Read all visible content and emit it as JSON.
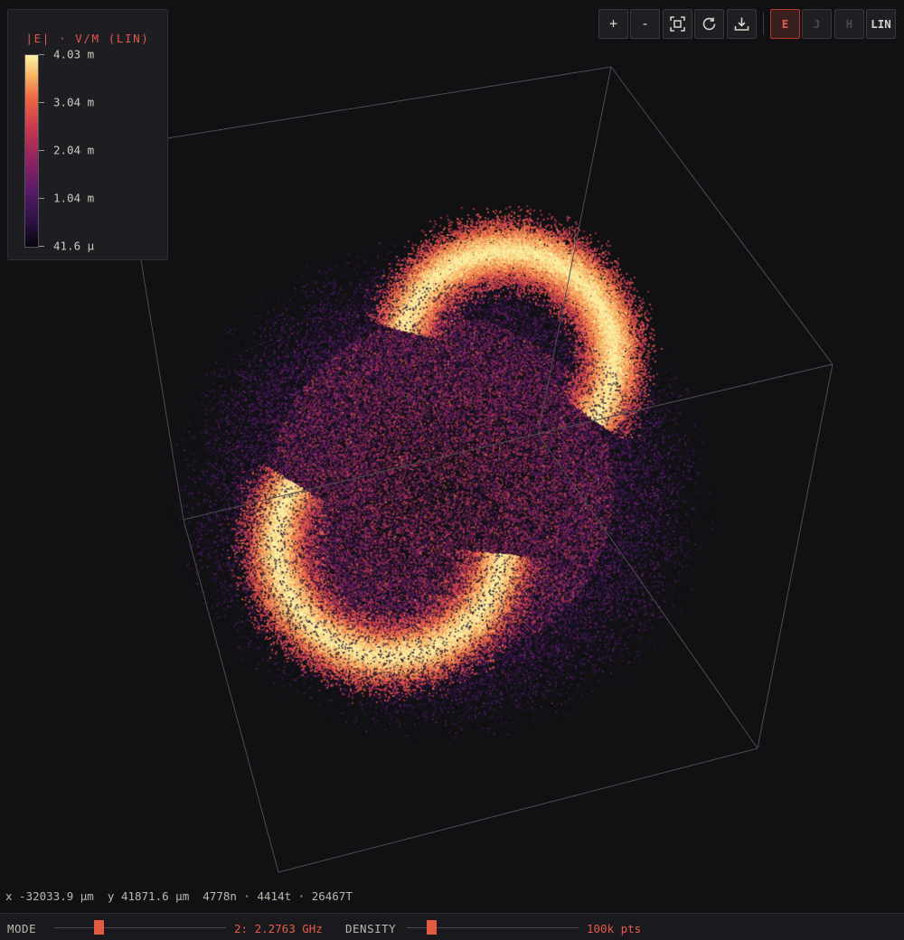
{
  "legend": {
    "title": "|E| · V/M (LIN)",
    "ticks": [
      "4.03 m",
      "3.04 m",
      "2.04 m",
      "1.04 m",
      "41.6 µ"
    ]
  },
  "toolbar": {
    "zoom_in": "+",
    "zoom_out": "-",
    "fit_icon": "fit-view-icon",
    "reset_icon": "rotate-reset-icon",
    "download_icon": "download-icon",
    "modes": [
      "E",
      "J",
      "H"
    ],
    "active_mode": "E",
    "scale": "LIN"
  },
  "readout": {
    "x": "x -32033.9 µm",
    "y": "y 41871.6 µm",
    "stats": "4778n · 4414t · 26467T"
  },
  "footer": {
    "mode_label": "MODE",
    "mode_value": "2: 2.2763 GHz",
    "mode_slider_fraction": 0.26,
    "density_label": "DENSITY",
    "density_value": "100k pts",
    "density_slider_fraction": 0.14
  },
  "colors": {
    "background": "#111114",
    "accent": "#e25a3f",
    "colormap": [
      "#07050b",
      "#2c1243",
      "#551a66",
      "#8c2462",
      "#c8384f",
      "#ee6a45",
      "#f9b867",
      "#fbf1a5"
    ]
  }
}
